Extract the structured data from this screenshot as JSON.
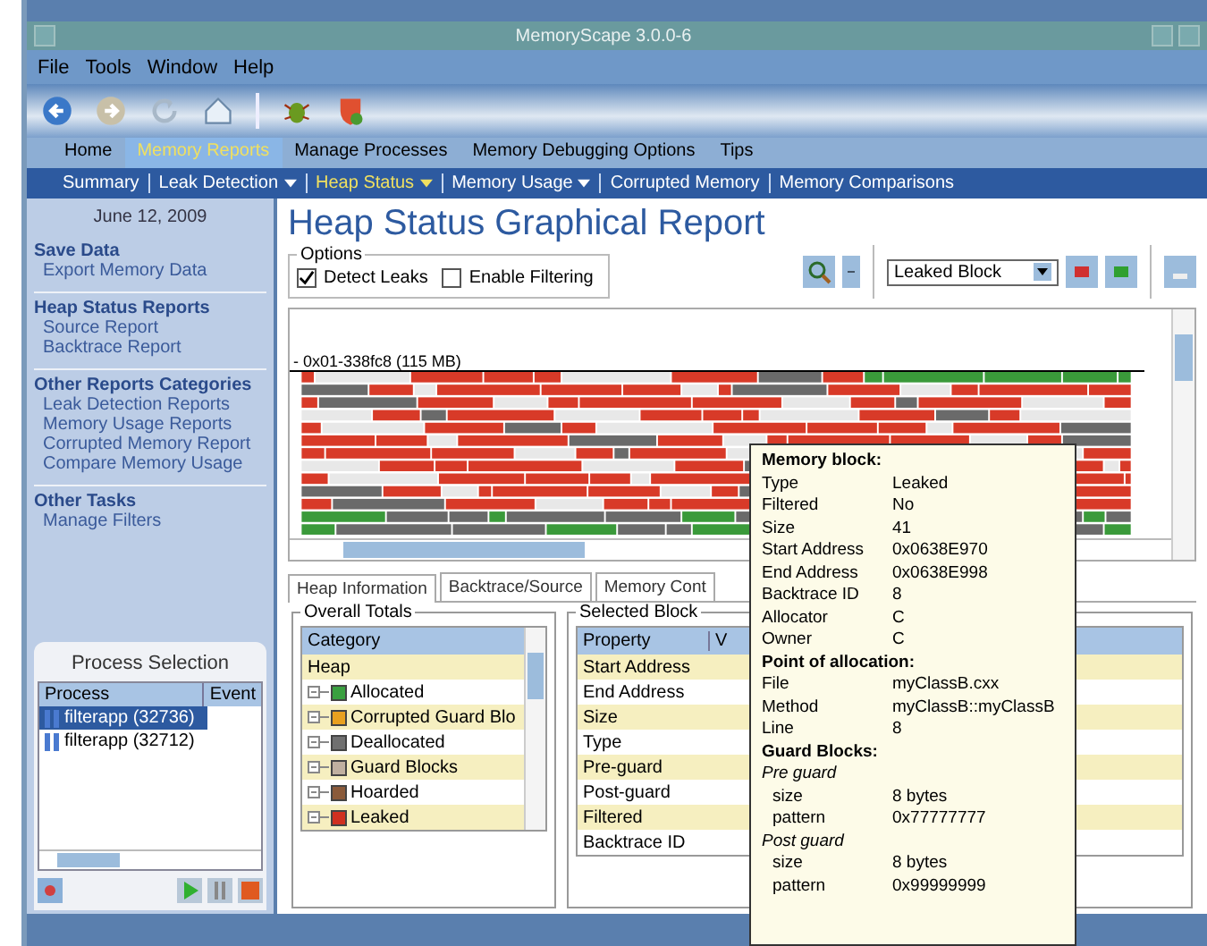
{
  "window": {
    "title": "MemoryScape 3.0.0-6"
  },
  "menu": [
    "File",
    "Tools",
    "Window",
    "Help"
  ],
  "main_tabs": [
    {
      "label": "Home",
      "selected": false
    },
    {
      "label": "Memory Reports",
      "selected": true
    },
    {
      "label": "Manage Processes",
      "selected": false
    },
    {
      "label": "Memory Debugging Options",
      "selected": false
    },
    {
      "label": "Tips",
      "selected": false
    }
  ],
  "sub_tabs": [
    {
      "label": "Summary",
      "dropdown": false,
      "selected": false
    },
    {
      "label": "Leak Detection",
      "dropdown": true,
      "selected": false
    },
    {
      "label": "Heap Status",
      "dropdown": true,
      "selected": true
    },
    {
      "label": "Memory Usage",
      "dropdown": true,
      "selected": false
    },
    {
      "label": "Corrupted Memory",
      "dropdown": false,
      "selected": false
    },
    {
      "label": "Memory Comparisons",
      "dropdown": false,
      "selected": false
    }
  ],
  "sidebar": {
    "date": "June 12, 2009",
    "sections": [
      {
        "heading": "Save Data",
        "links": [
          "Export Memory Data"
        ]
      },
      {
        "heading": "Heap Status Reports",
        "links": [
          "Source Report",
          "Backtrace Report"
        ]
      },
      {
        "heading": "Other Reports Categories",
        "links": [
          "Leak Detection Reports",
          "Memory Usage Reports",
          "Corrupted Memory Report",
          "Compare Memory Usage"
        ]
      },
      {
        "heading": "Other Tasks",
        "links": [
          "Manage Filters"
        ]
      }
    ]
  },
  "process_selection": {
    "title": "Process Selection",
    "columns": [
      "Process",
      "Event"
    ],
    "rows": [
      {
        "name": "filterapp (32736)",
        "selected": true
      },
      {
        "name": "filterapp (32712)",
        "selected": false
      }
    ]
  },
  "report": {
    "title": "Heap Status Graphical Report",
    "options_legend": "Options",
    "checkboxes": [
      {
        "label": "Detect Leaks",
        "checked": true
      },
      {
        "label": "Enable Filtering",
        "checked": false
      }
    ],
    "block_filter": "Leaked Block",
    "map_label": "- 0x01-338fc8 (115 MB)"
  },
  "bottom_tabs": [
    {
      "label": "Heap Information",
      "selected": true
    },
    {
      "label": "Backtrace/Source",
      "selected": false
    },
    {
      "label": "Memory Cont",
      "selected": false
    }
  ],
  "overall_totals": {
    "legend": "Overall Totals",
    "column": "Category",
    "rows": [
      {
        "label": "Heap",
        "children": [
          {
            "label": "Allocated",
            "color": "#3aa040"
          },
          {
            "label": "Corrupted Guard Blo",
            "color": "#e8a020"
          },
          {
            "label": "Deallocated",
            "color": "#707070"
          },
          {
            "label": "Guard Blocks",
            "color": "#c0b0a0"
          },
          {
            "label": "Hoarded",
            "color": "#8a5a3a"
          },
          {
            "label": "Leaked",
            "color": "#d03020"
          }
        ]
      }
    ]
  },
  "selected_block": {
    "legend": "Selected Block",
    "columns": [
      "Property",
      "V"
    ],
    "rows": [
      "Start Address",
      "End Address",
      "Size",
      "Type",
      "Pre-guard",
      "Post-guard",
      "Filtered",
      "Backtrace ID"
    ]
  },
  "tooltip": [
    {
      "kind": "heading",
      "label": "Memory block:"
    },
    {
      "kind": "field",
      "label": "Type",
      "value": "Leaked"
    },
    {
      "kind": "field",
      "label": "Filtered",
      "value": "No"
    },
    {
      "kind": "field",
      "label": "Size",
      "value": "41"
    },
    {
      "kind": "field",
      "label": "Start Address",
      "value": "0x0638E970"
    },
    {
      "kind": "field",
      "label": "End Address",
      "value": "0x0638E998"
    },
    {
      "kind": "field",
      "label": "Backtrace ID",
      "value": "8"
    },
    {
      "kind": "field",
      "label": "Allocator",
      "value": "C"
    },
    {
      "kind": "field",
      "label": "Owner",
      "value": "C"
    },
    {
      "kind": "heading",
      "label": "Point of allocation:"
    },
    {
      "kind": "field",
      "label": "File",
      "value": "myClassB.cxx"
    },
    {
      "kind": "field",
      "label": "Method",
      "value": "myClassB::myClassB"
    },
    {
      "kind": "field",
      "label": "Line",
      "value": "8"
    },
    {
      "kind": "heading",
      "label": "Guard Blocks:"
    },
    {
      "kind": "subheading",
      "label": "Pre guard"
    },
    {
      "kind": "subfield",
      "label": "size",
      "value": "8 bytes"
    },
    {
      "kind": "subfield",
      "label": "pattern",
      "value": "0x77777777"
    },
    {
      "kind": "subheading",
      "label": "Post guard"
    },
    {
      "kind": "subfield",
      "label": "size",
      "value": "8 bytes"
    },
    {
      "kind": "subfield",
      "label": "pattern",
      "value": "0x99999999"
    }
  ]
}
